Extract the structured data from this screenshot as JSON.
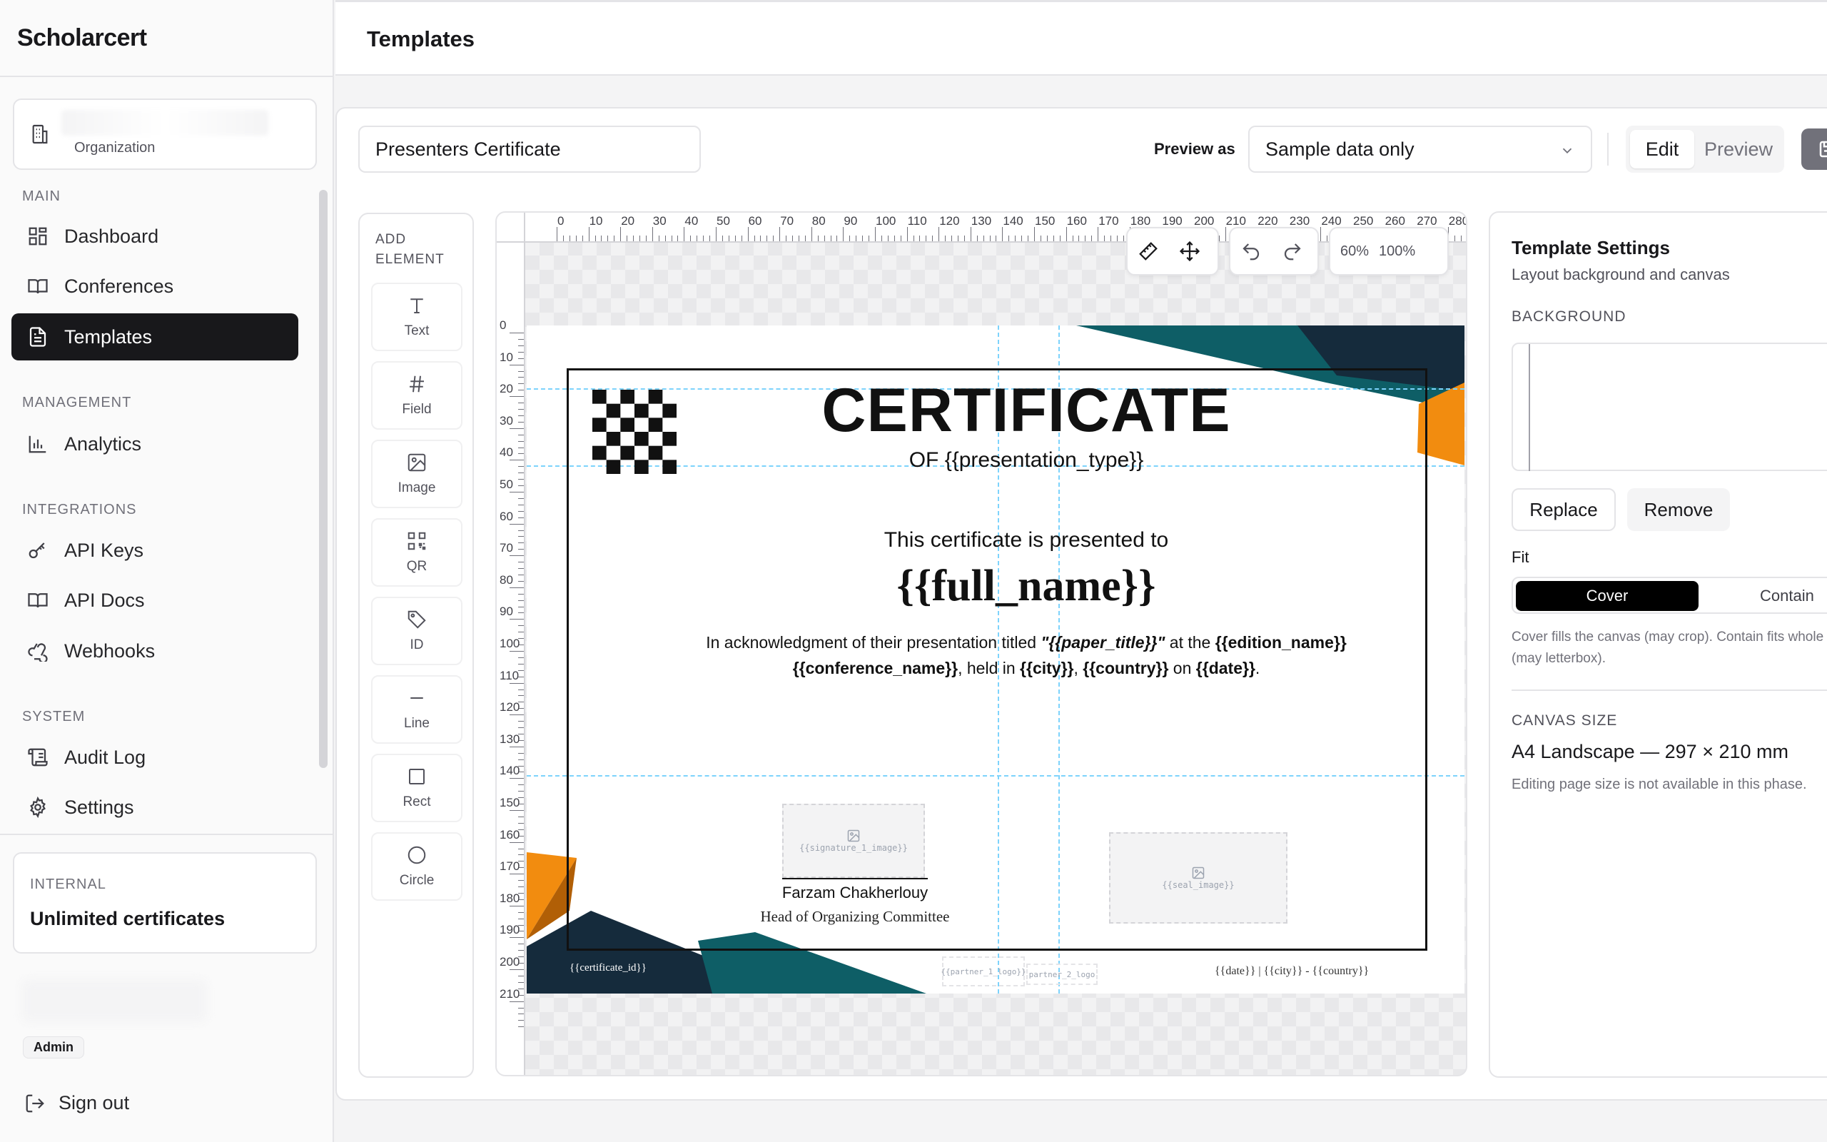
{
  "app": {
    "brand": "Scholarcert"
  },
  "header": {
    "title": "Templates"
  },
  "org": {
    "label": "Organization"
  },
  "sidebar": {
    "sections": {
      "main": "MAIN",
      "management": "MANAGEMENT",
      "integrations": "INTEGRATIONS",
      "system": "SYSTEM"
    },
    "items": {
      "dashboard": "Dashboard",
      "conferences": "Conferences",
      "templates": "Templates",
      "analytics": "Analytics",
      "api_keys": "API Keys",
      "api_docs": "API Docs",
      "webhooks": "Webhooks",
      "audit_log": "Audit Log",
      "settings": "Settings"
    },
    "active": "templates",
    "plan": {
      "label": "INTERNAL",
      "value": "Unlimited certificates"
    },
    "user": {
      "role": "Admin"
    },
    "signout": "Sign out"
  },
  "editor": {
    "template_name": "Presenters Certificate",
    "preview_label": "Preview as",
    "preview_value": "Sample data only",
    "mode": {
      "edit": "Edit",
      "preview": "Preview",
      "active": "edit"
    }
  },
  "toolbox": {
    "header_line1": "ADD",
    "header_line2": "ELEMENT",
    "tools": [
      "Text",
      "Field",
      "Image",
      "QR",
      "ID",
      "Line",
      "Rect",
      "Circle"
    ]
  },
  "canvas": {
    "zoom_options": [
      "60%",
      "100%"
    ],
    "ruler_top": [
      "0",
      "10",
      "20",
      "30",
      "40",
      "50",
      "60",
      "70",
      "80",
      "90",
      "100",
      "110",
      "120",
      "130",
      "140",
      "150",
      "160",
      "170",
      "180",
      "190",
      "200",
      "210",
      "220",
      "230",
      "240",
      "250",
      "260",
      "270",
      "280"
    ],
    "ruler_left": [
      "0",
      "10",
      "20",
      "30",
      "40",
      "50",
      "60",
      "70",
      "80",
      "90",
      "100",
      "110",
      "120",
      "130",
      "140",
      "150",
      "160",
      "170",
      "180",
      "190",
      "200",
      "210"
    ]
  },
  "certificate": {
    "title": "CERTIFICATE",
    "subtitle": "OF {{presentation_type}}",
    "presented": "This certificate is presented to",
    "name": "{{full_name}}",
    "body_1": "In acknowledgment of their presentation titled ",
    "body_paper": "\"{{paper_title}}\"",
    "body_2": " at the ",
    "body_edition": "{{edition_name}}",
    "body_conference": "{{conference_name}}",
    "body_3": ", held in ",
    "body_city": "{{city}}",
    "body_4": ", ",
    "body_country": "{{country}}",
    "body_5": " on ",
    "body_date": "{{date}}",
    "body_6": ".",
    "signature_placeholder": "{{signature_1_image}}",
    "signer_name": "Farzam Chakherlouy",
    "signer_role": "Head of Organizing Committee",
    "seal_placeholder": "{{seal_image}}",
    "certificate_id": "{{certificate_id}}",
    "partner1": "{{partner_1_logo}}",
    "partner2": "partner_2_logo",
    "footer_meta": "{{date}} | {{city}} - {{country}}",
    "colors": {
      "teal": "#0e5e66",
      "navy": "#152b3c",
      "orange": "#f28c0f"
    }
  },
  "settings": {
    "title": "Template Settings",
    "subtitle": "Layout background and canvas",
    "background_label": "BACKGROUND",
    "replace": "Replace",
    "remove": "Remove",
    "fit_label": "Fit",
    "fit_cover": "Cover",
    "fit_contain": "Contain",
    "fit_help": "Cover fills the canvas (may crop). Contain fits whole image (may letterbox).",
    "canvas_size_label": "CANVAS SIZE",
    "canvas_size_value": "A4 Landscape — 297 × 210 mm",
    "canvas_note": "Editing page size is not available in this phase."
  }
}
